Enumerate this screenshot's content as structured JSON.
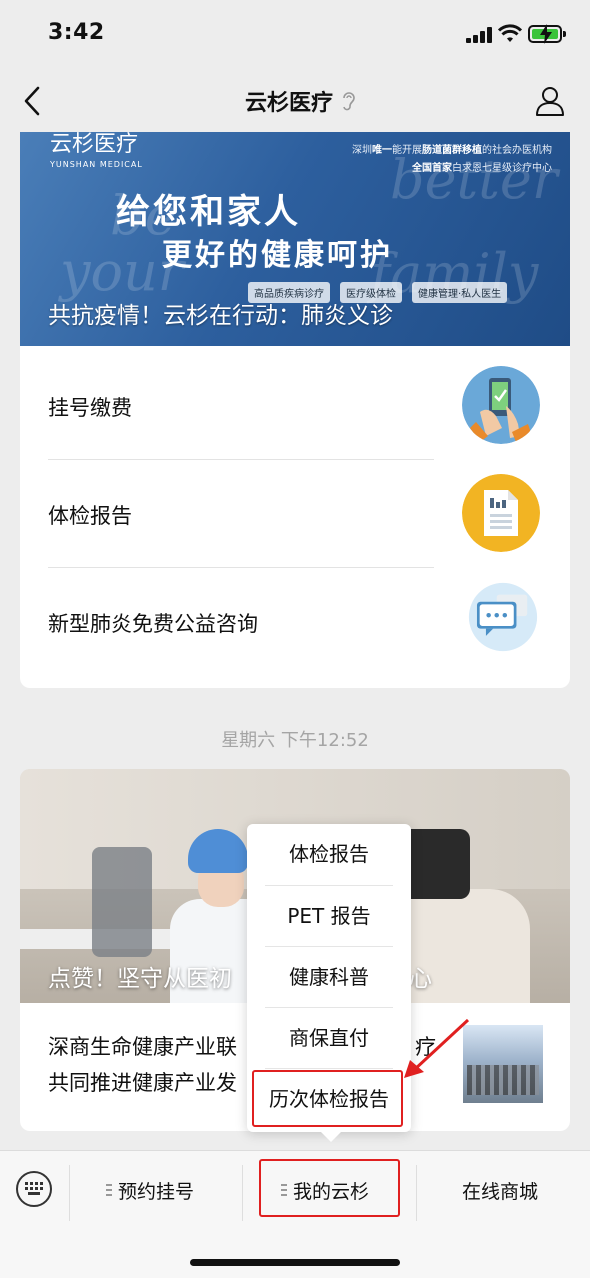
{
  "status_bar": {
    "time": "3:42"
  },
  "nav": {
    "title": "云杉医疗"
  },
  "banner": {
    "logo_text": "云杉医疗",
    "logo_sub": "YUNSHAN MEDICAL",
    "lines": [
      {
        "pre": "深圳",
        "bold": "唯一",
        "mid": "能开展",
        "bold2": "肠道菌群移植",
        "post": "的社会办医机构"
      },
      {
        "pre": "",
        "bold": "全国首家",
        "mid": "白求恩七星级诊疗中心",
        "bold2": "",
        "post": ""
      }
    ],
    "headline1": "给您和家人",
    "headline2": "更好的健康呵护",
    "tags": [
      "高品质疾病诊疗",
      "医疗级体检",
      "健康管理·私人医生"
    ],
    "bg_words": [
      "better",
      "your",
      "family",
      "be"
    ],
    "caption": "共抗疫情！云杉在行动：肺炎义诊"
  },
  "menu": {
    "items": [
      {
        "label": "挂号缴费",
        "icon": "phone-payment-icon"
      },
      {
        "label": "体检报告",
        "icon": "report-document-icon"
      },
      {
        "label": "新型肺炎免费公益咨询",
        "icon": "chat-bubble-icon"
      }
    ]
  },
  "timestamp": "星期六 下午12:52",
  "article": {
    "caption": "点赞！坚守从医初",
    "caption_tail": "爱心",
    "line1": "深商生命健康产业联",
    "line1_tail": "疗",
    "line2": "共同推进健康产业发"
  },
  "popup": {
    "items": [
      "体检报告",
      "PET 报告",
      "健康科普",
      "商保直付",
      "历次体检报告"
    ],
    "highlighted_index": 4
  },
  "bottom_bar": {
    "tabs": [
      "预约挂号",
      "我的云杉",
      "在线商城"
    ],
    "highlighted_tab": 1
  },
  "colors": {
    "background": "#ededed",
    "highlight": "#e02020",
    "icon_blue": "#6aa8d8",
    "icon_yellow": "#f2b423",
    "icon_lightblue": "#d6eaf8"
  }
}
